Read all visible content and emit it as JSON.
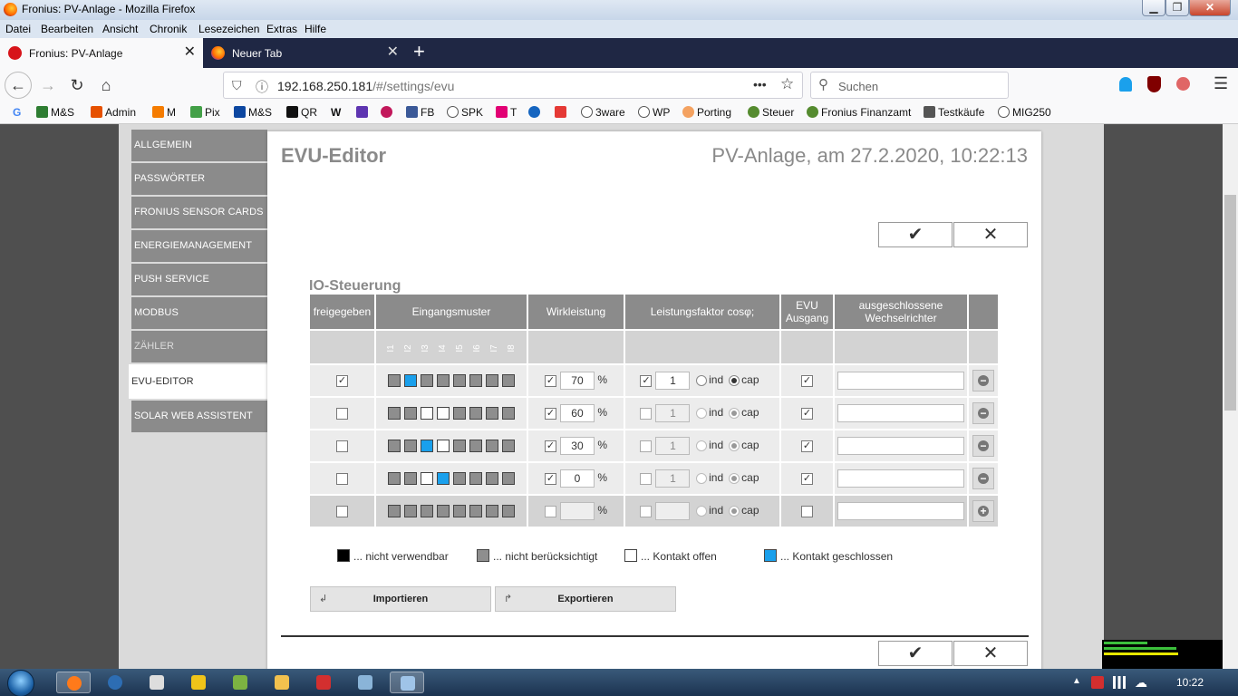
{
  "window": {
    "title": "Fronius: PV-Anlage - Mozilla Firefox"
  },
  "menu": [
    "Datei",
    "Bearbeiten",
    "Ansicht",
    "Chronik",
    "Lesezeichen",
    "Extras",
    "Hilfe"
  ],
  "tabs": [
    {
      "label": "Fronius: PV-Anlage",
      "active": true
    },
    {
      "label": "Neuer Tab",
      "active": false
    }
  ],
  "nav": {
    "url_host": "192.168.250.181",
    "url_path": "/#/settings/evu",
    "search_placeholder": "Suchen",
    "page_actions": "•••"
  },
  "bookmarks": [
    "G",
    "M&S",
    "Admin",
    "M",
    "Pix",
    "M&S",
    "QR",
    "W",
    "",
    "",
    "FB",
    "SPK",
    "T",
    "G",
    "",
    "3ware",
    "WP",
    "Porting",
    "Steuer",
    "Fronius Finanzamt",
    "Testkäufe",
    "MIG250"
  ],
  "sidebar": {
    "items": [
      {
        "label": "ALLGEMEIN"
      },
      {
        "label": "PASSWÖRTER"
      },
      {
        "label": "FRONIUS SENSOR CARDS"
      },
      {
        "label": "ENERGIEMANAGEMENT"
      },
      {
        "label": "PUSH SERVICE"
      },
      {
        "label": "MODBUS"
      },
      {
        "label": "ZÄHLER"
      },
      {
        "label": "EVU-EDITOR",
        "active": true
      },
      {
        "label": "SOLAR WEB ASSISTENT"
      }
    ]
  },
  "editor": {
    "title": "EVU-Editor",
    "timestamp": "PV-Anlage, am 27.2.2020, 10:22:13",
    "confirm_icon": "✔",
    "cancel_icon": "✕",
    "section": "IO-Steuerung",
    "columns": {
      "enabled": "freigegeben",
      "pattern": "Eingangsmuster",
      "power": "Wirkleistung",
      "cosphi": "Leistungsfaktor cosφ;",
      "evu_out_1": "EVU",
      "evu_out_2": "Ausgang",
      "excluded_1": "ausgeschlossene",
      "excluded_2": "Wechselrichter"
    },
    "pins": [
      "I1",
      "I2",
      "I3",
      "I4",
      "I5",
      "I6",
      "I7",
      "I8"
    ],
    "rows": [
      {
        "enabled": true,
        "pattern": [
          "g",
          "b",
          "g",
          "g",
          "g",
          "g",
          "g",
          "g"
        ],
        "power_on": true,
        "power": "70",
        "cos_on": true,
        "cos": "1",
        "mode": "cap",
        "evu": true,
        "action": "minus"
      },
      {
        "enabled": false,
        "pattern": [
          "g",
          "g",
          "w",
          "w",
          "g",
          "g",
          "g",
          "g"
        ],
        "power_on": true,
        "power": "60",
        "cos_on": false,
        "cos": "1",
        "mode": "cap",
        "evu": true,
        "action": "minus"
      },
      {
        "enabled": false,
        "pattern": [
          "g",
          "g",
          "b",
          "w",
          "g",
          "g",
          "g",
          "g"
        ],
        "power_on": true,
        "power": "30",
        "cos_on": false,
        "cos": "1",
        "mode": "cap",
        "evu": true,
        "action": "minus"
      },
      {
        "enabled": false,
        "pattern": [
          "g",
          "g",
          "w",
          "b",
          "g",
          "g",
          "g",
          "g"
        ],
        "power_on": true,
        "power": "0",
        "cos_on": false,
        "cos": "1",
        "mode": "cap",
        "evu": true,
        "action": "minus"
      },
      {
        "enabled": false,
        "pattern": [
          "g",
          "g",
          "g",
          "g",
          "g",
          "g",
          "g",
          "g"
        ],
        "power_on": false,
        "power": "",
        "cos_on": false,
        "cos": "",
        "mode": "cap",
        "evu": false,
        "action": "plus"
      }
    ],
    "percent": "%",
    "ind": "ind",
    "cap": "cap",
    "legend": [
      {
        "color": "k",
        "label": "... nicht verwendbar"
      },
      {
        "color": "g",
        "label": "... nicht berücksichtigt"
      },
      {
        "color": "w",
        "label": "... Kontakt offen"
      },
      {
        "color": "b",
        "label": "... Kontakt geschlossen"
      }
    ],
    "import_label": "Importieren",
    "export_label": "Exportieren",
    "import_icon": "↲",
    "export_icon": "↱"
  },
  "taskbar": {
    "clock": "10:22"
  }
}
